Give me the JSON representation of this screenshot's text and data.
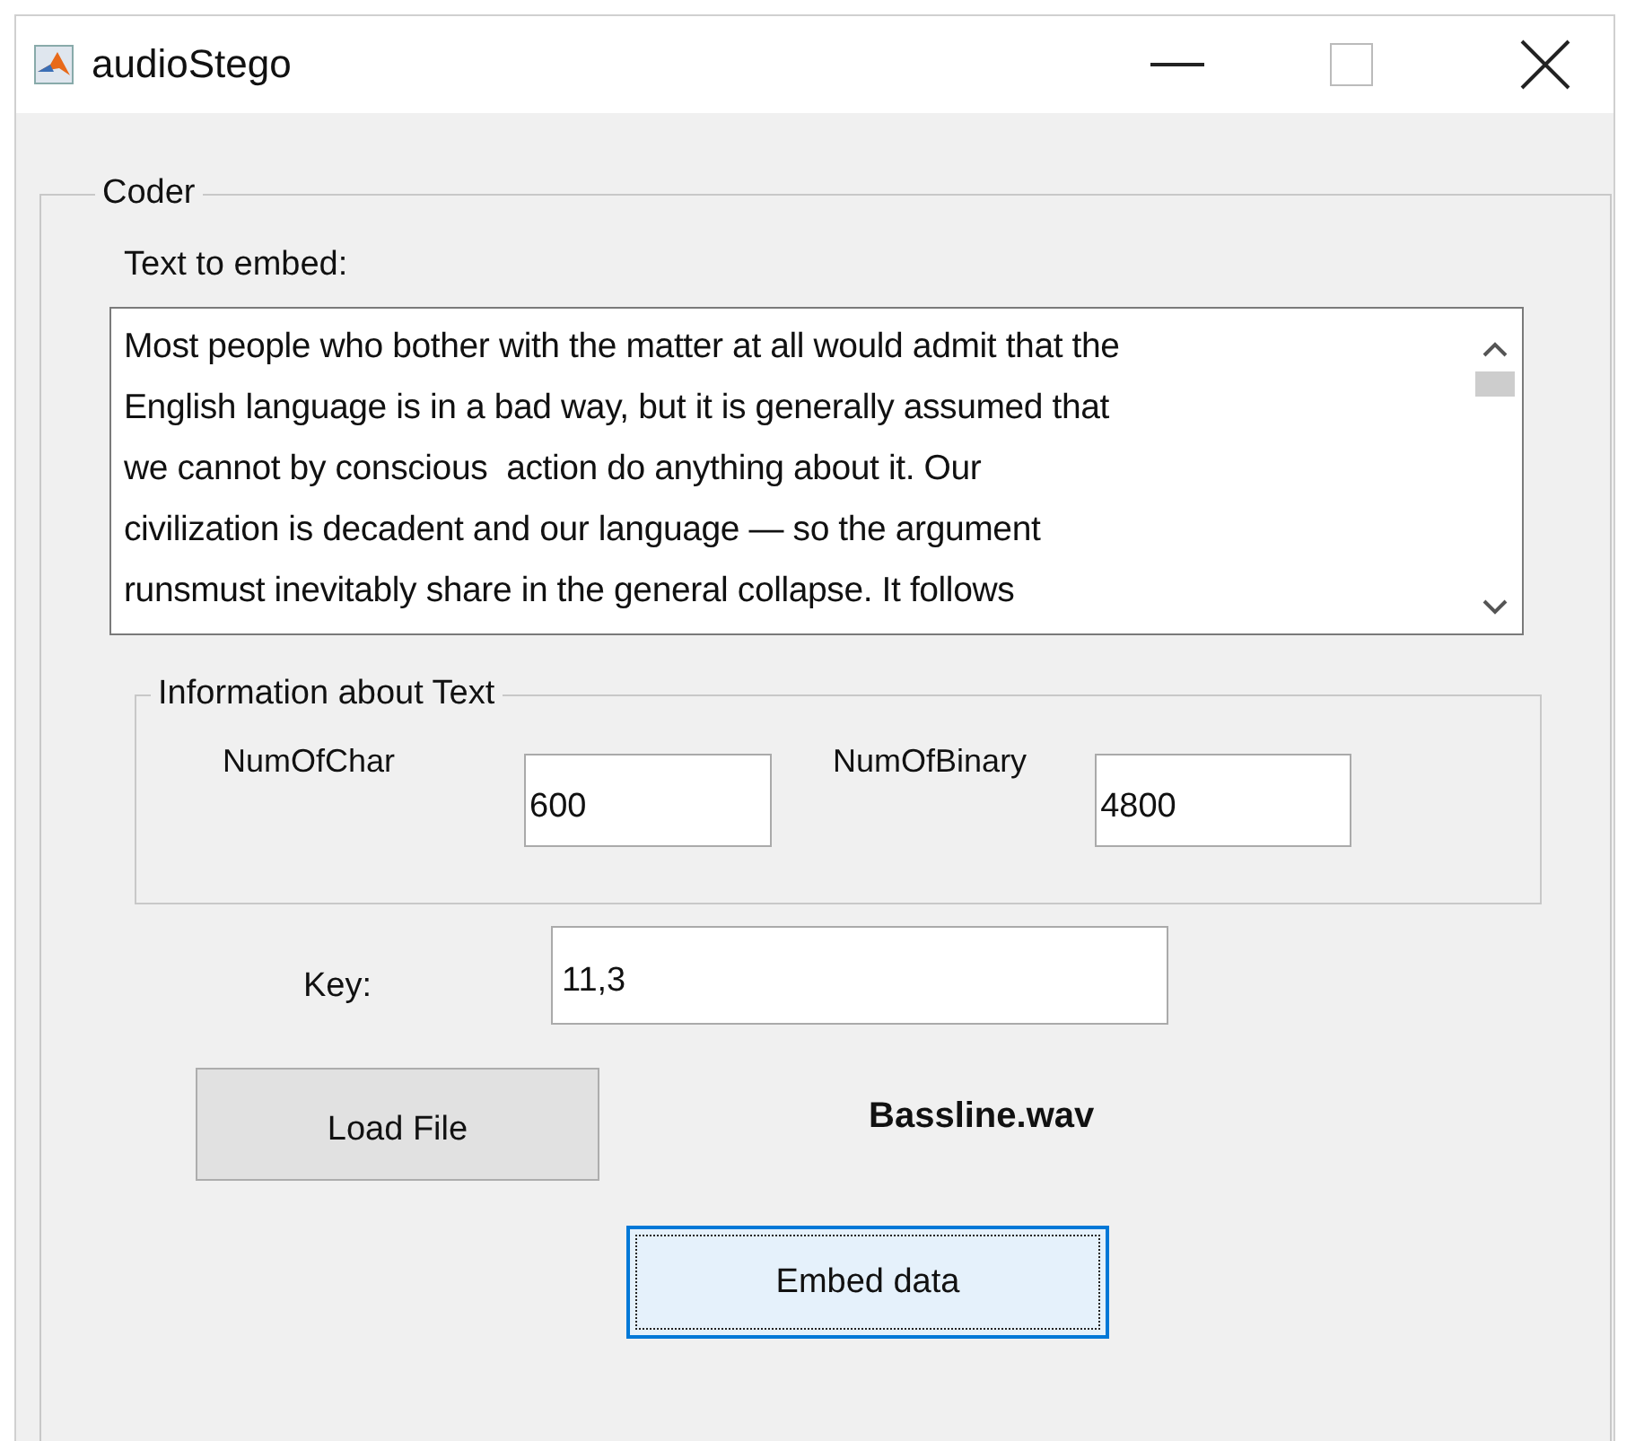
{
  "window": {
    "title": "audioStego"
  },
  "coder": {
    "title": "Coder",
    "text_label": "Text to embed:",
    "text": "Most people who bother with the matter at all would admit that the\nEnglish language is in a bad way, but it is generally assumed that\nwe cannot by conscious  action do anything about it. Our\ncivilization is decadent and our language — so the argument\nrunsmust inevitably share in the general collapse. It follows",
    "info": {
      "title": "Information about Text",
      "fields": [
        {
          "label": "NumOfChar",
          "value": "600"
        },
        {
          "label": "NumOfBinary",
          "value": "4800"
        }
      ]
    },
    "key": {
      "label": "Key:",
      "value": "11,3"
    },
    "load_button": "Load File",
    "file_name": "Bassline.wav",
    "embed_button": {
      "label": "Embed data",
      "focused": true
    }
  }
}
